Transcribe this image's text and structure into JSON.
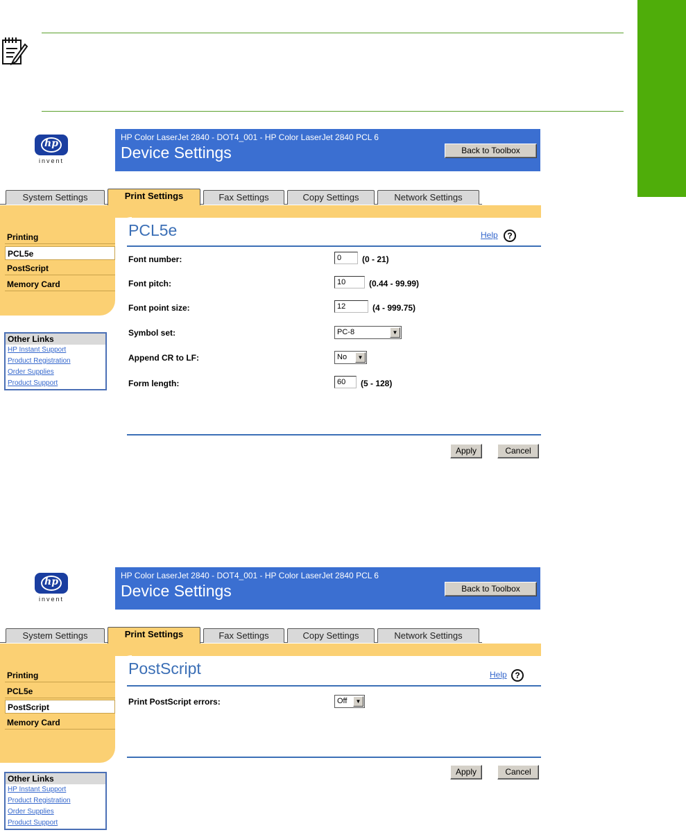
{
  "note": {
    "icon": "note-pad-icon"
  },
  "screen1": {
    "logo": {
      "mark": "hp",
      "tagline": "invent"
    },
    "banner": {
      "subtitle": "HP Color LaserJet 2840 - DOT4_001 - HP Color LaserJet 2840 PCL 6",
      "title": "Device Settings",
      "back_button": "Back to Toolbox"
    },
    "tabs": [
      "System Settings",
      "Print Settings",
      "Fax Settings",
      "Copy Settings",
      "Network Settings"
    ],
    "active_tab": "Print Settings",
    "nav": [
      "Printing",
      "PCL5e",
      "PostScript",
      "Memory Card"
    ],
    "selected_nav": "PCL5e",
    "page_title": "PCL5e",
    "help": "Help",
    "fields": [
      {
        "label": "Font number:",
        "value": "0",
        "range": "(0 - 21)"
      },
      {
        "label": "Font pitch:",
        "value": "10",
        "range": "(0.44 - 99.99)"
      },
      {
        "label": "Font point size:",
        "value": "12",
        "range": "(4 - 999.75)"
      },
      {
        "label": "Symbol set:",
        "value": "PC-8"
      },
      {
        "label": "Append CR to LF:",
        "value": "No"
      },
      {
        "label": "Form length:",
        "value": "60",
        "range": "(5 - 128)"
      }
    ],
    "other_links": {
      "heading": "Other Links",
      "links": [
        "HP Instant Support",
        "Product Registration",
        "Order Supplies",
        "Product Support"
      ]
    },
    "apply": "Apply",
    "cancel": "Cancel"
  },
  "screen2": {
    "logo": {
      "mark": "hp",
      "tagline": "invent"
    },
    "banner": {
      "subtitle": "HP Color LaserJet 2840 - DOT4_001 - HP Color LaserJet 2840 PCL 6",
      "title": "Device Settings",
      "back_button": "Back to Toolbox"
    },
    "tabs": [
      "System Settings",
      "Print Settings",
      "Fax Settings",
      "Copy Settings",
      "Network Settings"
    ],
    "active_tab": "Print Settings",
    "nav": [
      "Printing",
      "PCL5e",
      "PostScript",
      "Memory Card"
    ],
    "selected_nav": "PostScript",
    "page_title": "PostScript",
    "help": "Help",
    "fields": [
      {
        "label": "Print PostScript errors:",
        "value": "Off"
      }
    ],
    "other_links": {
      "heading": "Other Links",
      "links": [
        "HP Instant Support",
        "Product Registration",
        "Order Supplies",
        "Product Support"
      ]
    },
    "apply": "Apply",
    "cancel": "Cancel"
  },
  "colors": {
    "banner_blue": "#3b6fd1",
    "tab_yellow": "#fbd073",
    "green_accent": "#4fad0a",
    "title_blue": "#3b6fb6"
  }
}
